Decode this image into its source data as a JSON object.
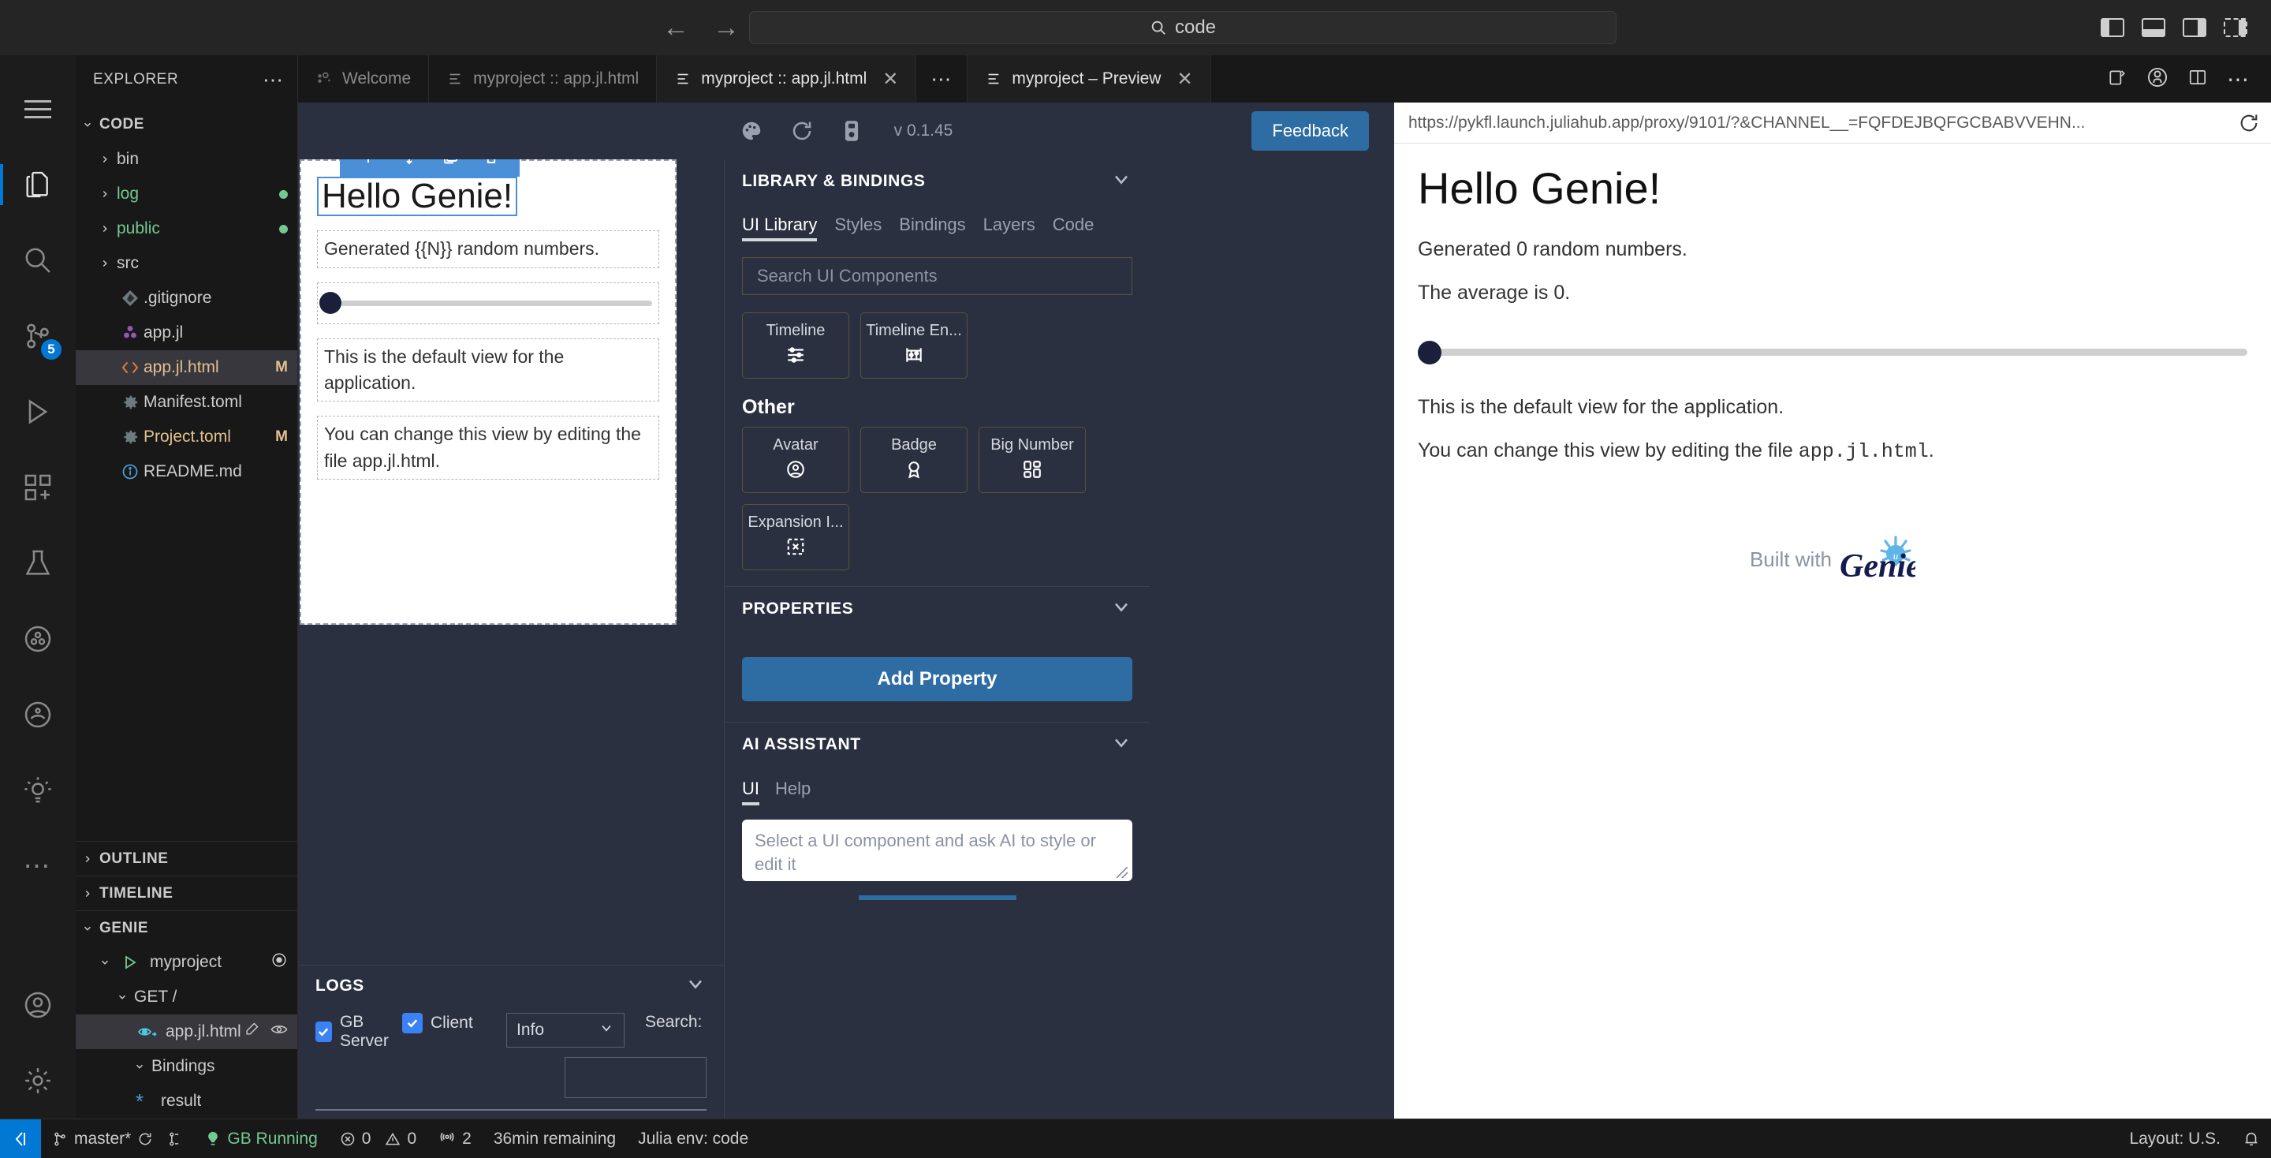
{
  "titlebar": {
    "back_icon": "arrow-left-icon",
    "forward_icon": "arrow-right-icon",
    "search_label": "code",
    "search_icon": "search-icon"
  },
  "activitybar": {
    "menu_icon": "hamburger-menu-icon",
    "items": [
      {
        "name": "explorer",
        "icon": "files-icon",
        "badge": ""
      },
      {
        "name": "search",
        "icon": "search-icon",
        "badge": ""
      },
      {
        "name": "source-control",
        "icon": "source-control-icon",
        "badge": "5"
      },
      {
        "name": "run-and-debug",
        "icon": "run-debug-icon",
        "badge": ""
      },
      {
        "name": "extensions",
        "icon": "extensions-icon",
        "badge": ""
      },
      {
        "name": "testing",
        "icon": "beaker-icon",
        "badge": ""
      },
      {
        "name": "julia-plots",
        "icon": "julia-plots-icon",
        "badge": ""
      },
      {
        "name": "julia-workspace",
        "icon": "julia-workspace-icon",
        "badge": ""
      },
      {
        "name": "genie-builder",
        "icon": "genie-lamp-icon",
        "badge": ""
      },
      {
        "name": "more-views",
        "icon": "ellipsis-icon",
        "badge": ""
      }
    ],
    "bottom_items": [
      {
        "name": "accounts",
        "icon": "account-icon"
      },
      {
        "name": "settings",
        "icon": "gear-icon"
      }
    ]
  },
  "sidebar": {
    "title": "EXPLORER",
    "more_icon": "ellipsis-icon",
    "root": "CODE",
    "tree": [
      {
        "label": "bin",
        "kind": "folder",
        "icon": "chevron-right-icon",
        "modified": "",
        "dirty": false
      },
      {
        "label": "log",
        "kind": "folder",
        "icon": "chevron-right-icon",
        "modified": "",
        "dirty": true
      },
      {
        "label": "public",
        "kind": "folder",
        "icon": "chevron-right-icon",
        "modified": "",
        "dirty": true
      },
      {
        "label": "src",
        "kind": "folder",
        "icon": "chevron-right-icon",
        "modified": "",
        "dirty": false
      },
      {
        "label": ".gitignore",
        "kind": "file",
        "icon": "git-icon",
        "modified": "",
        "dirty": false
      },
      {
        "label": "app.jl",
        "kind": "file",
        "icon": "julia-icon",
        "modified": "",
        "dirty": false
      },
      {
        "label": "app.jl.html",
        "kind": "file",
        "icon": "html-icon",
        "modified": "M",
        "dirty": false,
        "selected": true
      },
      {
        "label": "Manifest.toml",
        "kind": "file",
        "icon": "gear-icon",
        "modified": "",
        "dirty": false
      },
      {
        "label": "Project.toml",
        "kind": "file",
        "icon": "gear-icon",
        "modified": "M",
        "dirty": false
      },
      {
        "label": "README.md",
        "kind": "file",
        "icon": "info-icon",
        "modified": "",
        "dirty": false
      }
    ],
    "panels": [
      {
        "label": "OUTLINE",
        "expanded": false
      },
      {
        "label": "TIMELINE",
        "expanded": false
      },
      {
        "label": "GENIE",
        "expanded": true
      }
    ],
    "genie": {
      "project": "myproject",
      "project_run_icon": "play-icon",
      "project_status_icon": "record-icon",
      "route": "GET /",
      "page": "app.jl.html",
      "page_icon": "eye-icon",
      "page_actions": [
        "pencil-icon",
        "eye-icon"
      ],
      "bindings_label": "Bindings",
      "binding": "result",
      "binding_icon": "asterisk-icon"
    }
  },
  "tabs": [
    {
      "label": "Welcome",
      "icon": "vscode-logo-icon",
      "active": false,
      "closable": false
    },
    {
      "label": "myproject :: app.jl.html",
      "icon": "preview-icon",
      "active": false,
      "closable": false
    },
    {
      "label": "myproject :: app.jl.html",
      "icon": "preview-icon",
      "active": true,
      "closable": true
    }
  ],
  "tabs_right": [
    {
      "label": "myproject – Preview",
      "icon": "preview-icon",
      "active": true,
      "closable": true
    }
  ],
  "tab_actions": {
    "more_icon": "ellipsis-icon",
    "split_right_icon": "split-editor-icon",
    "github_icon": "github-icon",
    "layout_icon": "layout-icon",
    "overflow_icon": "ellipsis-icon"
  },
  "genie_builder": {
    "toolbar": {
      "theme_icon": "palette-icon",
      "refresh_icon": "refresh-icon",
      "save_icon": "save-icon",
      "version": "v 0.1.45",
      "feedback_label": "Feedback"
    },
    "canvas": {
      "heading": "Hello Genie!",
      "selection_tools": [
        "arrow-up-icon",
        "move-icon",
        "copy-icon",
        "trash-icon"
      ],
      "blocks": [
        "Generated {{N}} random numbers.",
        "This is the default view for the application.",
        "You can change this view by editing the file app.jl.html."
      ],
      "slider_value": 0
    },
    "logs": {
      "title": "LOGS",
      "collapse_icon": "chevron-down-icon",
      "checkboxes": [
        {
          "label": "GB Server",
          "checked": true
        },
        {
          "label": "Client",
          "checked": true
        }
      ],
      "level": "Info",
      "level_chevron": "chevron-down-icon",
      "search_label": "Search:",
      "search_value": ""
    },
    "library": {
      "title": "LIBRARY & BINDINGS",
      "collapse_icon": "chevron-down-icon",
      "tabs": [
        {
          "label": "UI Library",
          "active": true
        },
        {
          "label": "Styles",
          "active": false
        },
        {
          "label": "Bindings",
          "active": false
        },
        {
          "label": "Layers",
          "active": false
        },
        {
          "label": "Code",
          "active": false
        }
      ],
      "search_placeholder": "Search UI Components",
      "components_top": [
        {
          "label": "Timeline",
          "icon": "timeline-icon"
        },
        {
          "label": "Timeline En...",
          "icon": "timeline-entry-icon"
        }
      ],
      "group_other_label": "Other",
      "components_other": [
        {
          "label": "Avatar",
          "icon": "avatar-icon"
        },
        {
          "label": "Badge",
          "icon": "badge-icon"
        },
        {
          "label": "Big Number",
          "icon": "big-number-icon"
        },
        {
          "label": "Expansion I...",
          "icon": "expansion-icon"
        }
      ]
    },
    "properties": {
      "title": "PROPERTIES",
      "collapse_icon": "chevron-down-icon",
      "add_label": "Add Property"
    },
    "ai_assistant": {
      "title": "AI ASSISTANT",
      "collapse_icon": "chevron-down-icon",
      "tabs": [
        {
          "label": "UI",
          "active": true
        },
        {
          "label": "Help",
          "active": false
        }
      ],
      "input_placeholder": "Select a UI component and ask AI to style or edit it"
    }
  },
  "preview": {
    "url": "https://pykfl.launch.juliahub.app/proxy/9101/?&CHANNEL__=FQFDEJBQFGCBABVVEHN...",
    "reload_icon": "reload-icon",
    "heading": "Hello Genie!",
    "line1": "Generated 0 random numbers.",
    "line2": "The average is 0.",
    "slider_value": 0,
    "line3": "This is the default view for the application.",
    "line4_prefix": "You can change this view by editing the file ",
    "line4_code": "app.jl.html",
    "line4_suffix": ".",
    "footer_text": "Built with",
    "footer_brand": "Genie"
  },
  "statusbar": {
    "remote_icon": "remote-window-icon",
    "branch": "master*",
    "branch_icon": "source-control-icon",
    "sync_icon": "sync-icon",
    "branch_extra_icon": "source-control-icon",
    "gb_status": "GB Running",
    "gb_status_icon": "genie-lamp-icon",
    "errors": "0",
    "errors_icon": "error-icon",
    "warnings": "0",
    "warnings_icon": "warning-icon",
    "ports": "2",
    "ports_icon": "radio-tower-icon",
    "remaining": "36min remaining",
    "julia_env": "Julia env: code",
    "layout": "Layout: U.S.",
    "bell_icon": "bell-icon"
  },
  "colors": {
    "accent": "#0078d4",
    "genie_blue": "#2d6da3",
    "panel_bg": "#2b3040",
    "sidebar_bg": "#181818",
    "selection_blue": "#4a90d9",
    "green": "#73c991",
    "modified": "#e2c08d"
  }
}
